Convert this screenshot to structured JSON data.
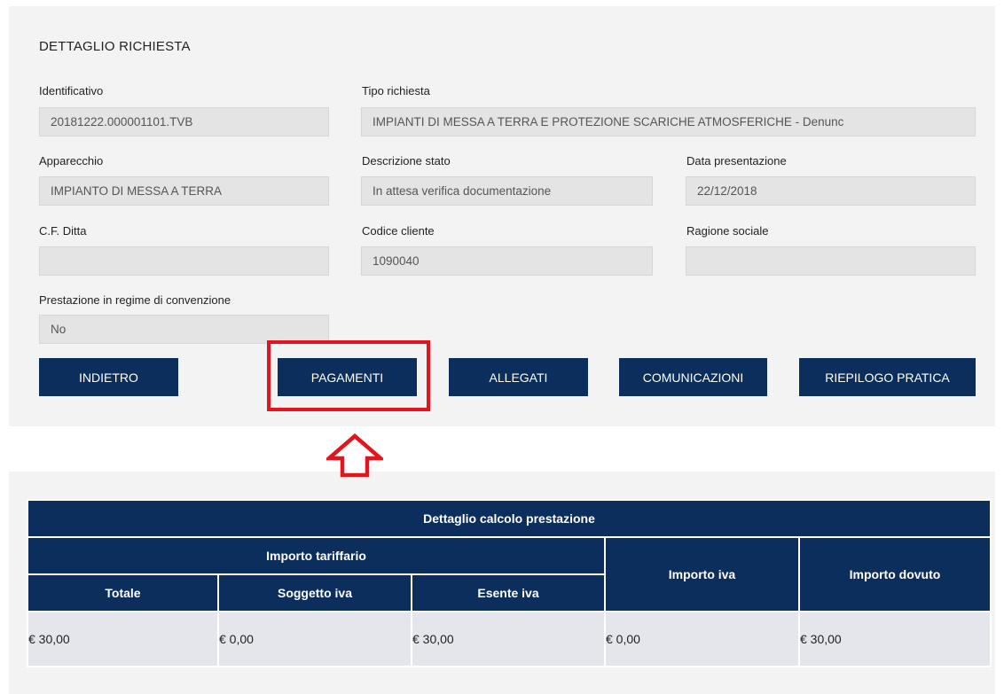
{
  "section_title": "DETTAGLIO RICHIESTA",
  "fields": {
    "identificativo": {
      "label": "Identificativo",
      "value": "20181222.000001101.TVB"
    },
    "tipo_richiesta": {
      "label": "Tipo richiesta",
      "value": "IMPIANTI DI MESSA A TERRA E PROTEZIONE SCARICHE ATMOSFERICHE - Denunc"
    },
    "apparecchio": {
      "label": "Apparecchio",
      "value": "IMPIANTO DI MESSA A TERRA"
    },
    "descrizione_stato": {
      "label": "Descrizione stato",
      "value": "In attesa verifica documentazione"
    },
    "data_presentazione": {
      "label": "Data presentazione",
      "value": "22/12/2018"
    },
    "cf_ditta": {
      "label": "C.F. Ditta",
      "value": ""
    },
    "codice_cliente": {
      "label": "Codice cliente",
      "value": "1090040"
    },
    "ragione_sociale": {
      "label": "Ragione sociale",
      "value": ""
    },
    "prestazione_convenzione": {
      "label": "Prestazione in regime di convenzione",
      "value": "No"
    }
  },
  "buttons": {
    "indietro": "INDIETRO",
    "pagamenti": "PAGAMENTI",
    "allegati": "ALLEGATI",
    "comunicazioni": "COMUNICAZIONI",
    "riepilogo": "RIEPILOGO PRATICA"
  },
  "colors": {
    "navy": "#0c2e5c",
    "highlight_red": "#e3141c",
    "panel_bg": "#f3f3f3",
    "field_bg": "#e4e4e4"
  },
  "table": {
    "title": "Dettaglio calcolo prestazione",
    "group_header": "Importo tariffario",
    "columns": {
      "totale": "Totale",
      "soggetto_iva": "Soggetto iva",
      "esente_iva": "Esente iva",
      "importo_iva": "Importo iva",
      "importo_dovuto": "Importo dovuto"
    },
    "row": [
      "€ 30,00",
      "€ 0,00",
      "€ 30,00",
      "€ 0,00",
      "€ 30,00"
    ]
  }
}
